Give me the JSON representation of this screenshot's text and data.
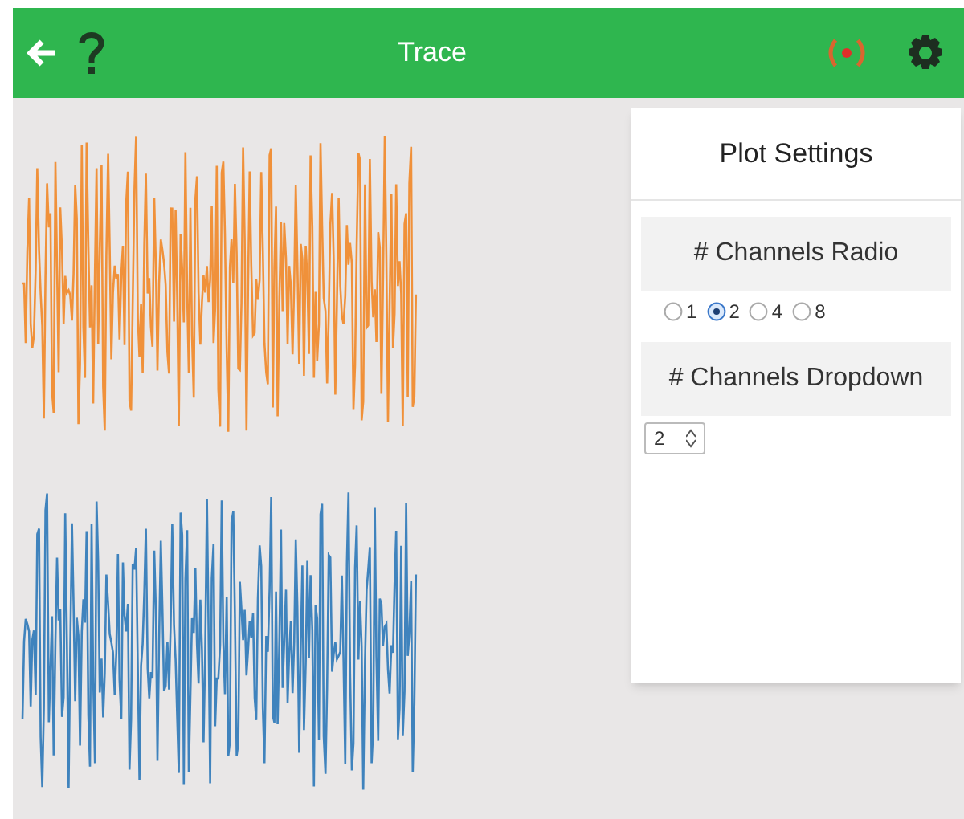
{
  "header": {
    "title": "Trace"
  },
  "traces": [
    {
      "color": "#f0913a"
    },
    {
      "color": "#3f83bd"
    }
  ],
  "plot_settings": {
    "title": "Plot Settings",
    "radio_section": {
      "heading": "# Channels Radio",
      "options": [
        {
          "label": "1",
          "selected": false
        },
        {
          "label": "2",
          "selected": true
        },
        {
          "label": "4",
          "selected": false
        },
        {
          "label": "8",
          "selected": false
        }
      ]
    },
    "dropdown_section": {
      "heading": "# Channels Dropdown",
      "value": "2"
    }
  }
}
